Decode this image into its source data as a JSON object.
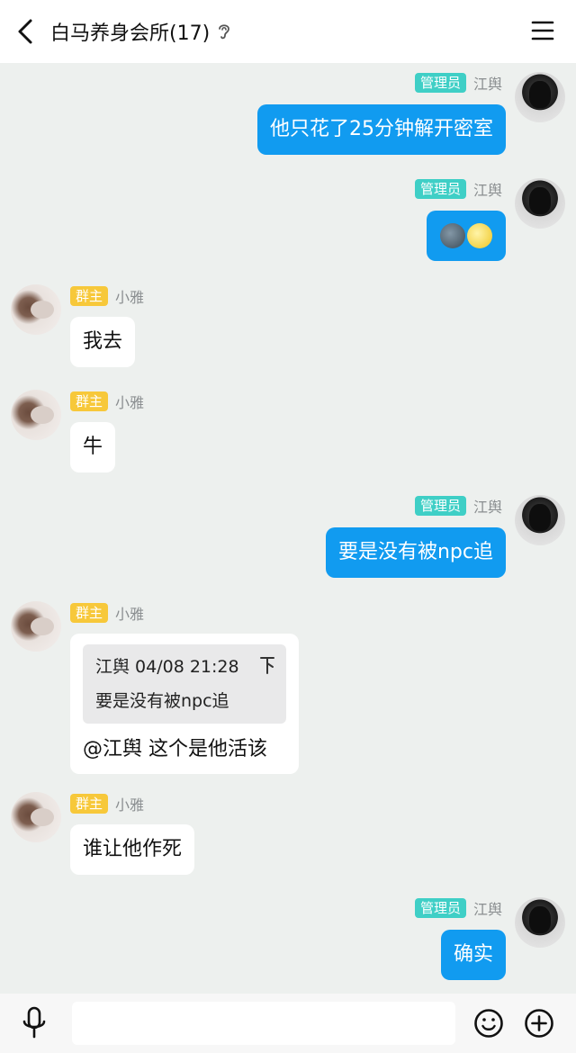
{
  "header": {
    "title": "白马养身会所(17)"
  },
  "messages": [
    {
      "side": "right",
      "badge": "管理员",
      "sender": "江舆",
      "text": "他只花了25分钟解开密室"
    },
    {
      "side": "right",
      "badge": "管理员",
      "sender": "江舆",
      "emojis": [
        "new-moon-face",
        "full-moon-face"
      ]
    },
    {
      "side": "left",
      "badge": "群主",
      "sender": "小雅",
      "text": "我去"
    },
    {
      "side": "left",
      "badge": "群主",
      "sender": "小雅",
      "text": "牛"
    },
    {
      "side": "right",
      "badge": "管理员",
      "sender": "江舆",
      "text": "要是没有被npc追"
    },
    {
      "side": "left",
      "badge": "群主",
      "sender": "小雅",
      "quote": {
        "author_time": "江舆 04/08 21:28",
        "text": "要是没有被npc追"
      },
      "text": "@江舆 这个是他活该"
    },
    {
      "side": "left",
      "badge": "群主",
      "sender": "小雅",
      "text": "谁让他作死"
    },
    {
      "side": "right",
      "badge": "管理员",
      "sender": "江舆",
      "text": "确实"
    }
  ],
  "input": {
    "value": ""
  },
  "colors": {
    "bubble_right": "#119bf0",
    "bubble_left": "#ffffff",
    "badge_admin": "#3fcfc6",
    "badge_owner": "#f7c83a",
    "chat_bg": "#edf0ee"
  }
}
